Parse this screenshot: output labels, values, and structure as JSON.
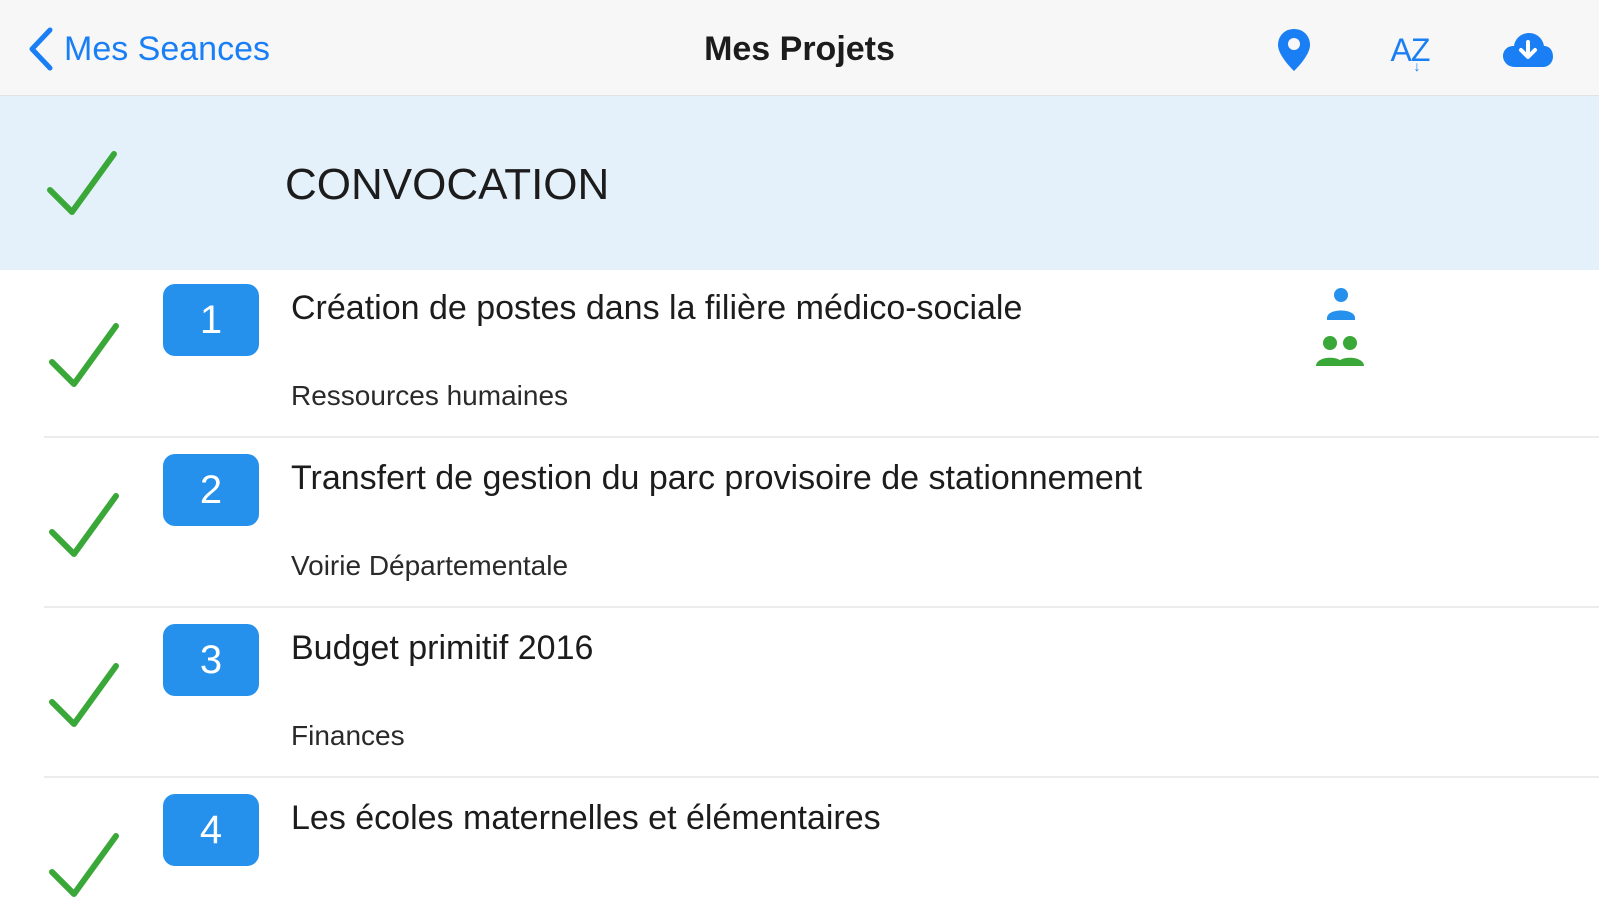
{
  "nav": {
    "back_label": "Mes Seances",
    "title": "Mes Projets",
    "icons": [
      "location-pin-icon",
      "sort-az-icon",
      "cloud-download-icon"
    ]
  },
  "section": {
    "title": "CONVOCATION",
    "checked": true
  },
  "items": [
    {
      "number": "1",
      "title": "Création de postes dans la filière médico-sociale",
      "subtitle": "Ressources humaines",
      "checked": true,
      "icons": [
        "person-icon",
        "group-icon"
      ]
    },
    {
      "number": "2",
      "title": "Transfert de gestion du parc provisoire de stationnement",
      "subtitle": "Voirie Départementale",
      "checked": true
    },
    {
      "number": "3",
      "title": "Budget primitif 2016",
      "subtitle": "Finances",
      "checked": true
    },
    {
      "number": "4",
      "title": "Les écoles maternelles et élémentaires",
      "subtitle": "",
      "checked": true
    }
  ],
  "colors": {
    "accent": "#1a7ff5",
    "badge": "#2591ed",
    "check": "#3aa839",
    "section_bg": "#e4f1fb",
    "person_blue": "#2591ed",
    "group_green": "#3aa839"
  }
}
